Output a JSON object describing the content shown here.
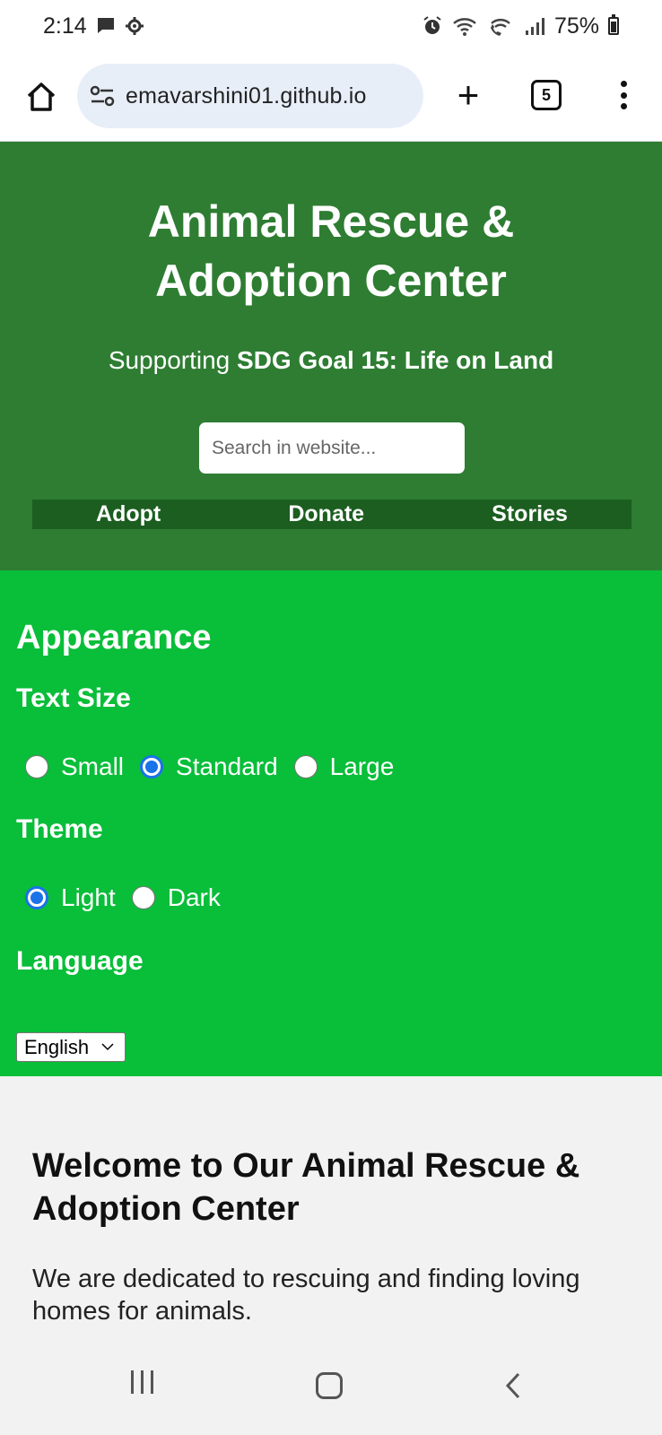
{
  "status": {
    "time": "2:14",
    "battery": "75%"
  },
  "browser": {
    "url": "emavarshini01.github.io",
    "tab_count": "5",
    "new_tab_label": "+"
  },
  "header": {
    "title": "Animal Rescue & Adoption Center",
    "subtitle_prefix": "Supporting",
    "subtitle_bold": "SDG Goal 15: Life on Land",
    "search_placeholder": "Search in website...",
    "nav": [
      "Adopt",
      "Donate",
      "Stories"
    ],
    "bg_color": "#2e7d32",
    "nav_bg_color": "#1b5e20"
  },
  "appearance": {
    "heading": "Appearance",
    "text_size_heading": "Text Size",
    "text_size_options": [
      "Small",
      "Standard",
      "Large"
    ],
    "text_size_selected": "Standard",
    "theme_heading": "Theme",
    "theme_options": [
      "Light",
      "Dark"
    ],
    "theme_selected": "Light",
    "language_heading": "Language",
    "language_selected": "English",
    "bg_color": "#09be39"
  },
  "welcome": {
    "heading": "Welcome to Our Animal Rescue & Adoption Center",
    "text": "We are dedicated to rescuing and finding loving homes for animals."
  }
}
